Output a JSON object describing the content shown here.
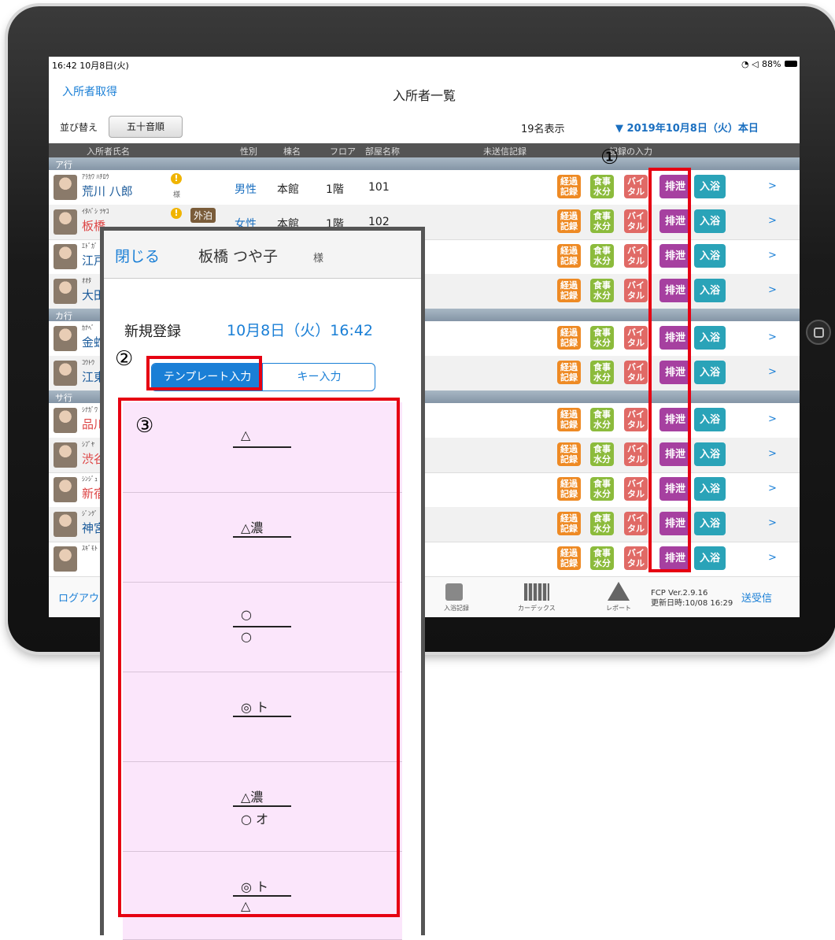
{
  "status": {
    "time": "16:42 10月8日(火)",
    "battery": "88%"
  },
  "nav": {
    "left": "入所者取得",
    "title": "入所者一覧"
  },
  "toolbar": {
    "sort_label": "並び替え",
    "sort_value": "五十音順",
    "count": "19名表示",
    "date": "▼ 2019年10月8日（火）本日"
  },
  "columns": [
    "入所者氏名",
    "性別",
    "棟名",
    "フロア",
    "部屋名称",
    "未送信記録",
    "記録の入力"
  ],
  "sections": [
    "ア行",
    "カ行",
    "サ行"
  ],
  "badges": {
    "keika": "経過\n記録",
    "shoku": "食事\n水分",
    "vital": "バイ\nタル",
    "haisetsu": "排泄",
    "nyuyoku": "入浴",
    "chevron": ">"
  },
  "rows": [
    {
      "kana": "ｱﾗｶﾜ ﾊﾁﾛｳ",
      "name": "荒川 八郎",
      "warn": "!",
      "sama": "様",
      "gender": "男性",
      "building": "本館",
      "floor": "1階",
      "room": "101"
    },
    {
      "kana": "ｲﾀﾊﾞｼ ﾂﾔｺ",
      "name": "板橋",
      "warn": "!",
      "gaihaku": "外泊",
      "gender": "女性",
      "building": "本館",
      "floor": "1階",
      "room": "102"
    },
    {
      "kana": "ｴﾄﾞｶﾞ",
      "name": "江戸"
    },
    {
      "kana": "ｵｵﾀ",
      "name": "大田"
    },
    {
      "kana": "ｶﾅﾍﾞ",
      "name": "金蛇"
    },
    {
      "kana": "ｺｳﾄｳ",
      "name": "江東"
    },
    {
      "kana": "ｼﾅｶﾞﾜ",
      "name": "品川"
    },
    {
      "kana": "ｼﾌﾞﾔ",
      "name": "渋谷"
    },
    {
      "kana": "ｼﾝｼﾞｭ",
      "name": "新宿"
    },
    {
      "kana": "ｼﾞﾝｸﾞ",
      "name": "神宮"
    },
    {
      "kana": "ｽｷﾞﾓﾄ",
      "name": ""
    }
  ],
  "tabbar": {
    "logout": "ログアウト",
    "bath": "入浴記録",
    "kardex": "カーデックス",
    "report": "レポート",
    "version": "FCP Ver.2.9.16",
    "updated": "更新日時:10/08 16:29",
    "send": "送受信"
  },
  "modal": {
    "close": "閉じる",
    "name": "板橋 つや子",
    "sama": "様",
    "register_label": "新規登録",
    "register_date": "10月8日（火）16:42",
    "seg_template": "テンプレート入力",
    "seg_key": "キー入力",
    "templates": [
      {
        "top": "△",
        "bottom": ""
      },
      {
        "top": "△濃",
        "bottom": ""
      },
      {
        "top": "○",
        "bottom": "○"
      },
      {
        "top": "◎ ト",
        "bottom": ""
      },
      {
        "top": "△濃",
        "bottom": "○ オ"
      },
      {
        "top": "◎ ト",
        "bottom": "△"
      }
    ]
  },
  "markers": {
    "one": "①",
    "two": "②",
    "three": "③"
  },
  "colors": {
    "accent": "#1a7fd6",
    "marker": "#e60012",
    "template_bg": "#fbe6fb"
  }
}
